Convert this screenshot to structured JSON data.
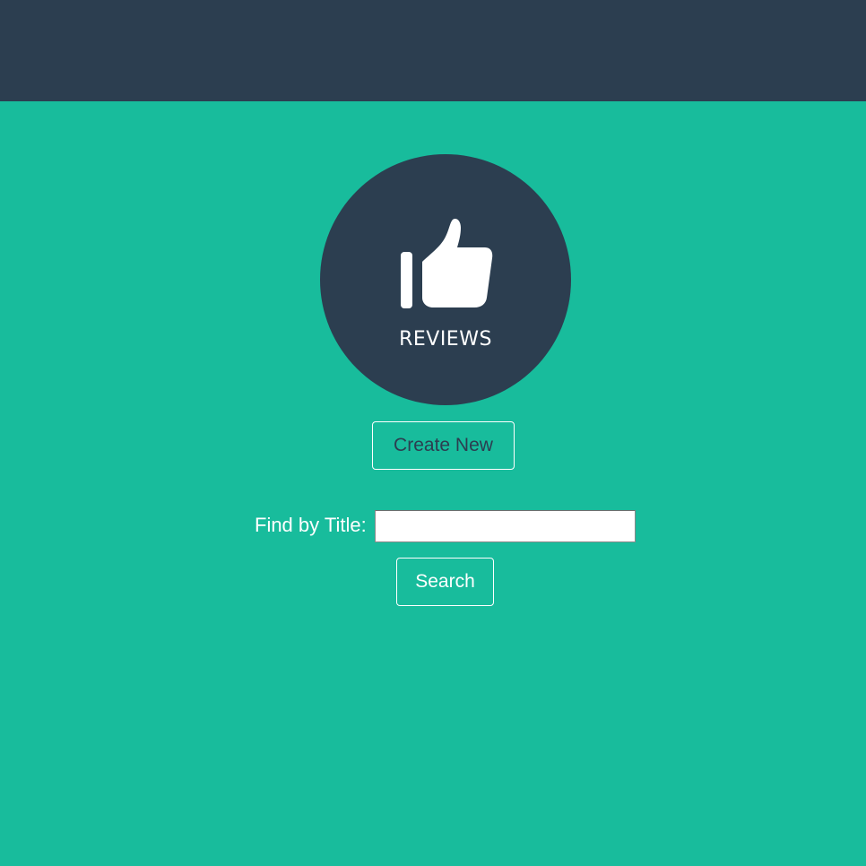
{
  "colors": {
    "header_bg": "#2c3e50",
    "page_bg": "#18bc9c",
    "logo_bg": "#2c3e50",
    "button_border": "#ffffff"
  },
  "logo": {
    "icon": "thumbs-up-icon",
    "text": "REVIEWS"
  },
  "actions": {
    "create_new_label": "Create New"
  },
  "search": {
    "label": "Find by Title:",
    "value": "",
    "placeholder": "",
    "button_label": "Search"
  }
}
